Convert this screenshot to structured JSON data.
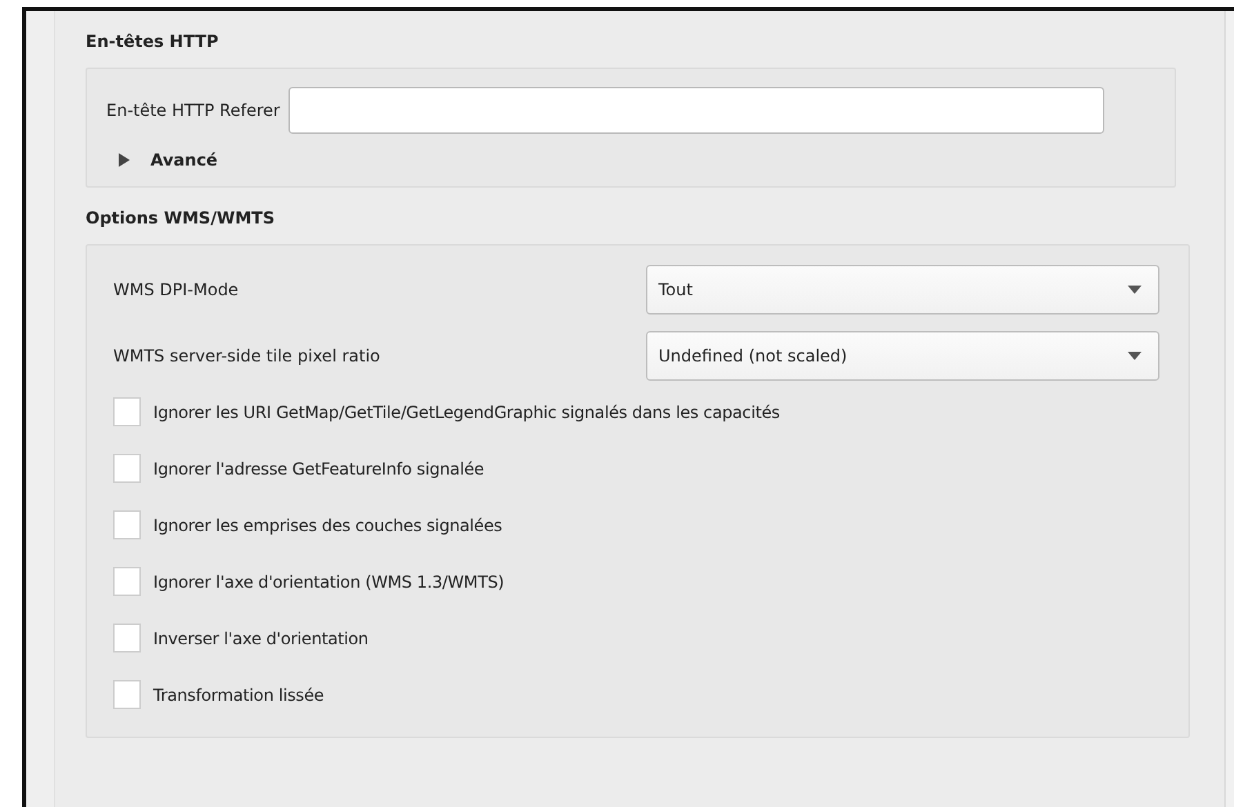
{
  "http_headers": {
    "title": "En-têtes HTTP",
    "referer": {
      "label": "En-tête HTTP Referer"
    },
    "advanced": {
      "label": "Avancé",
      "expanded": false
    }
  },
  "wms_options": {
    "title": "Options WMS/WMTS",
    "combos": [
      {
        "label": "WMS DPI-Mode",
        "value": "Tout"
      },
      {
        "label": "WMTS server-side tile pixel ratio",
        "value": "Undefined (not scaled)"
      }
    ],
    "checkboxes": [
      {
        "label": "Ignorer les URI GetMap/GetTile/GetLegendGraphic signalés dans les capacités",
        "checked": false
      },
      {
        "label": "Ignorer l'adresse GetFeatureInfo signalée",
        "checked": false
      },
      {
        "label": "Ignorer les emprises des couches signalées",
        "checked": false
      },
      {
        "label": "Ignorer l'axe d'orientation (WMS 1.3/WMTS)",
        "checked": false
      },
      {
        "label": "Inverser l'axe d'orientation",
        "checked": false
      },
      {
        "label": "Transformation lissée",
        "checked": false
      }
    ]
  }
}
